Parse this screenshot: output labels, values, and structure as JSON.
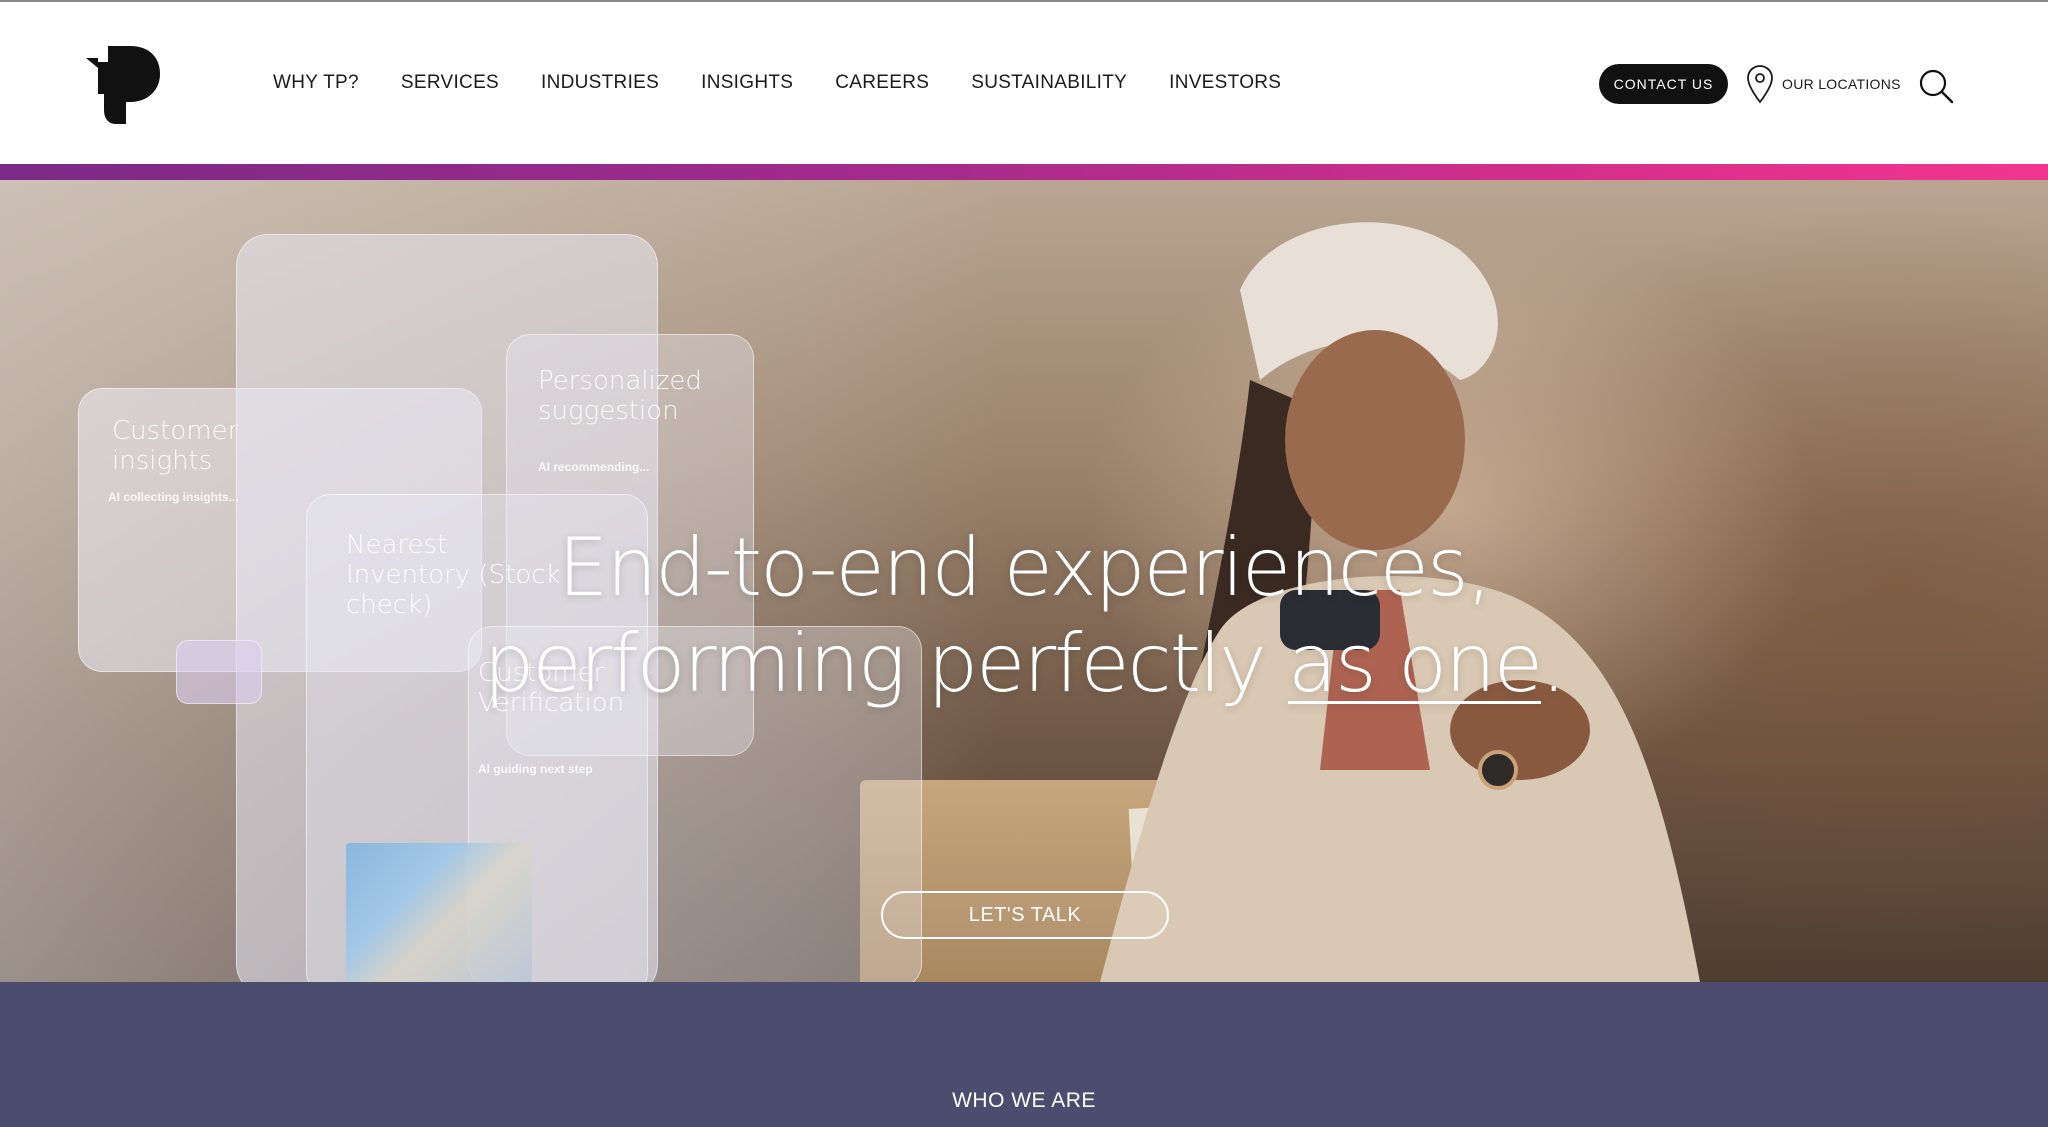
{
  "header": {
    "logo": "tp-logo",
    "nav": [
      "WHY TP?",
      "SERVICES",
      "INDUSTRIES",
      "INSIGHTS",
      "CAREERS",
      "SUSTAINABILITY",
      "INVESTORS"
    ],
    "contact_label": "CONTACT US",
    "locations_label": "OUR LOCATIONS",
    "locations_icon": "map-pin-icon",
    "search_icon": "search-icon"
  },
  "colors": {
    "gradient_start": "#7b2a87",
    "gradient_end": "#f2368f",
    "who_bg": "#4c4d6e",
    "contact_bg": "#111111"
  },
  "hero": {
    "headline_line1": "End-to-end experiences,",
    "headline_line2_pre": "performing perfectly ",
    "headline_line2_emph": "as one",
    "headline_line2_post": ".",
    "cta_label": "LET'S TALK",
    "panels": {
      "customer_insights": "Customer insights",
      "ai_collecting": "AI collecting insights...",
      "personalized": "Personalized suggestion",
      "ai_recommending": "AI recommending...",
      "nearest_inventory": "Nearest Inventory (Stock check)",
      "customer_verification": "Customer Verification",
      "ai_guiding": "AI guiding next step"
    }
  },
  "who": {
    "title": "WHO WE ARE"
  }
}
